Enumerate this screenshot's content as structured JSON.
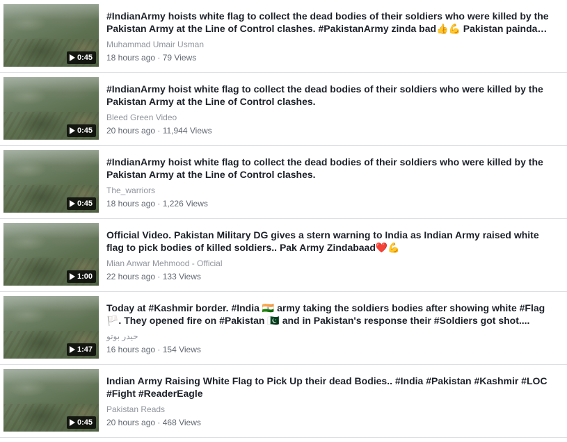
{
  "videos": [
    {
      "title": "#IndianArmy hoists white flag to collect the dead bodies of their soldiers who were killed by the Pakistan Army at the Line of Control clashes. #PakistanArmy zinda bad👍💪 Pakistan painda…",
      "channel": "Muhammad Umair Usman",
      "meta": "18 hours ago · 79 Views",
      "duration": "0:45"
    },
    {
      "title": "#IndianArmy hoist white flag to collect the dead bodies of their soldiers who were killed by the Pakistan Army at the Line of Control clashes.",
      "channel": "Bleed Green Video",
      "meta": "20 hours ago · 11,944 Views",
      "duration": "0:45"
    },
    {
      "title": "#IndianArmy hoist white flag to collect the dead bodies of their soldiers who were killed by the Pakistan Army at the Line of Control clashes.",
      "channel": "The_warriors",
      "meta": "18 hours ago · 1,226 Views",
      "duration": "0:45"
    },
    {
      "title": "Official Video. Pakistan Military DG gives a stern warning to India as Indian Army raised white flag to pick bodies of killed soldiers.. Pak Army Zindabaad❤️💪",
      "channel": "Mian Anwar Mehmood - Official",
      "meta": "22 hours ago · 133 Views",
      "duration": "1:00"
    },
    {
      "title": "Today at #Kashmir border. #India 🇮🇳 army taking the soldiers bodies after showing white #Flag 🏳️. They opened fire on #Pakistan 🇵🇰 and in Pakistan's response their #Soldiers got shot....",
      "channel": "حیدر بوتو",
      "meta": "16 hours ago · 154 Views",
      "duration": "1:47"
    },
    {
      "title": "Indian Army Raising White Flag to Pick Up their dead Bodies.. #India #Pakistan #Kashmir #LOC #Fight #ReaderEagle",
      "channel": "Pakistan Reads",
      "meta": "20 hours ago · 468 Views",
      "duration": "0:45"
    }
  ]
}
